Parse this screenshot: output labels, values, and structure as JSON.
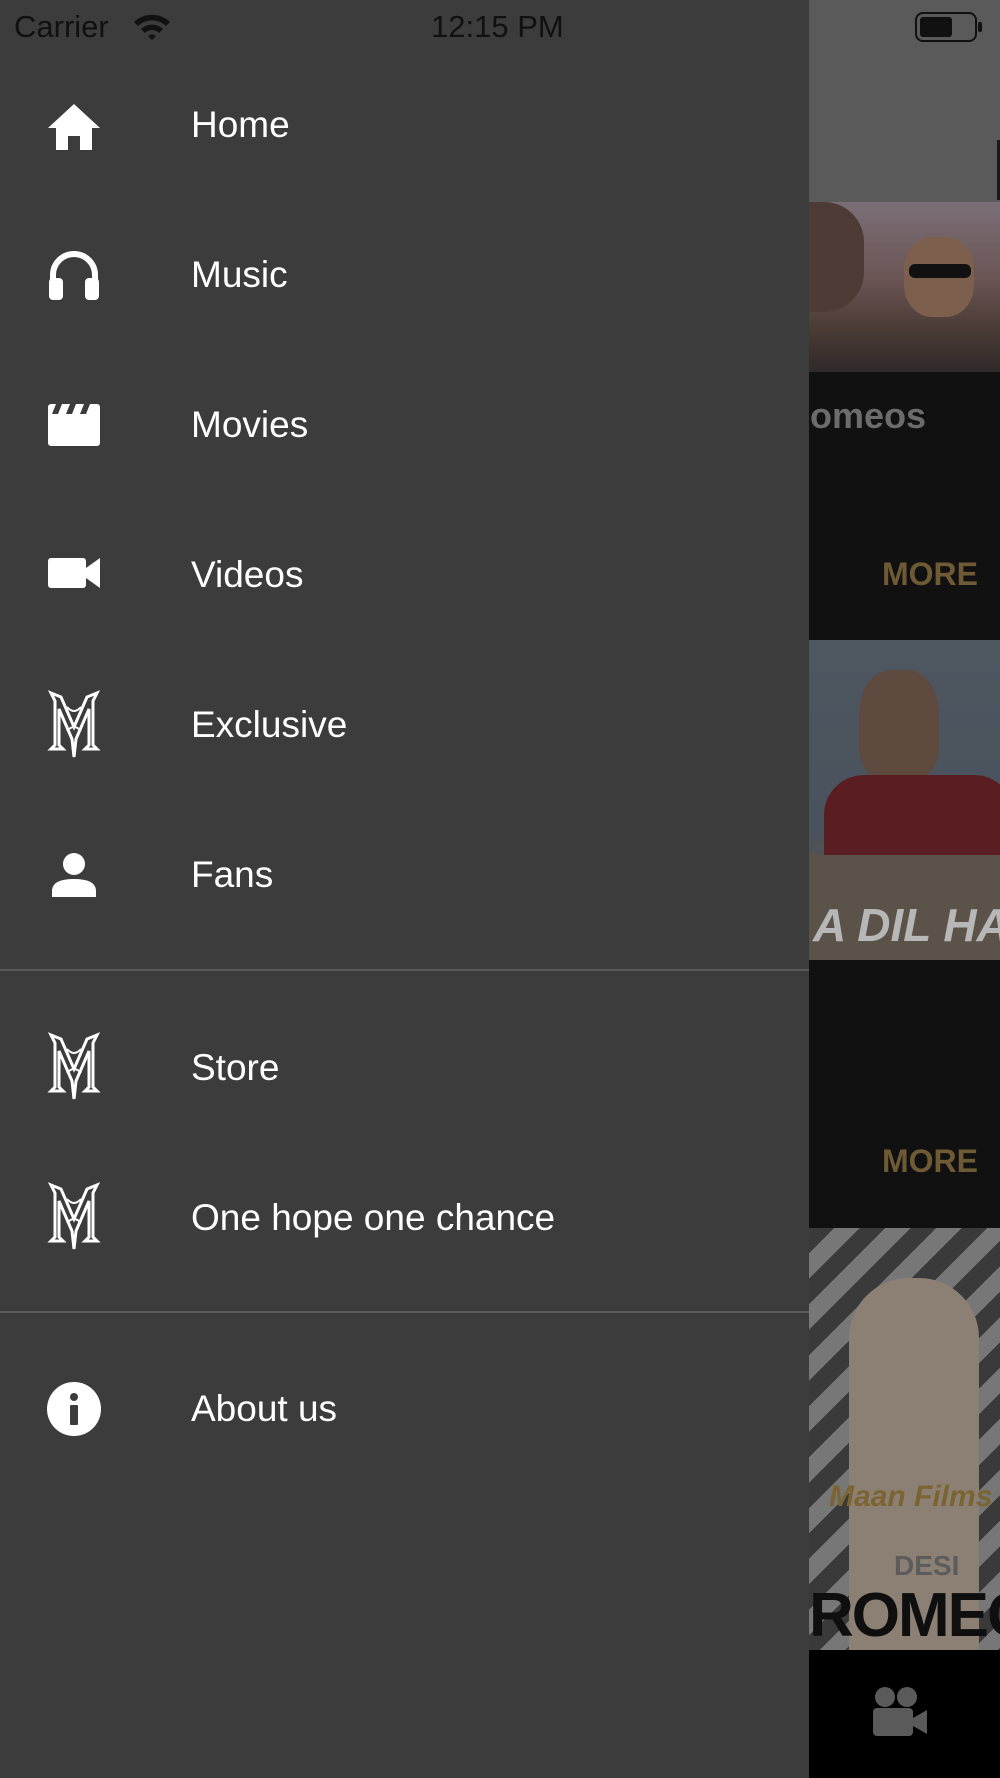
{
  "status_bar": {
    "carrier": "Carrier",
    "time": "12:15 PM"
  },
  "drawer": {
    "primary_items": [
      {
        "label": "Home",
        "icon": "home-icon"
      },
      {
        "label": "Music",
        "icon": "headphones-icon"
      },
      {
        "label": "Movies",
        "icon": "clapperboard-icon"
      },
      {
        "label": "Videos",
        "icon": "videocam-icon"
      },
      {
        "label": "Exclusive",
        "icon": "monogram-logo-icon"
      },
      {
        "label": "Fans",
        "icon": "person-icon"
      }
    ],
    "secondary_items": [
      {
        "label": "Store",
        "icon": "monogram-logo-icon"
      },
      {
        "label": "One hope one chance",
        "icon": "monogram-logo-icon"
      }
    ],
    "tertiary_items": [
      {
        "label": "About us",
        "icon": "info-icon"
      }
    ]
  },
  "background": {
    "section_title_partial": "omeos",
    "more_label": "MORE",
    "thumb2_caption": "A DIL HAI",
    "thumb3_brand": "Maan Films",
    "thumb3_title_top": "DESI",
    "thumb3_title_bottom": "ROMEO",
    "tabbar_icon": "movie-camera-icon"
  },
  "colors": {
    "drawer_bg": "#3c3c3c",
    "divider": "#5a5a5a",
    "text": "#ffffff",
    "more_accent": "#6e5a35"
  }
}
